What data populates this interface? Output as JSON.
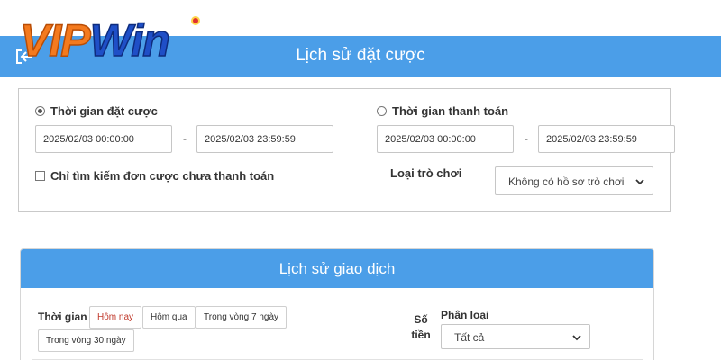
{
  "logo": {
    "part1": "VIP",
    "part2": "Win"
  },
  "bet_history": {
    "title": "Lịch sử đặt cược",
    "filters": {
      "bet_time_label": "Thời gian đặt cược",
      "bet_time_selected": true,
      "bet_start": "2025/02/03 00:00:00",
      "bet_end": "2025/02/03 23:59:59",
      "payment_time_label": "Thời gian thanh toán",
      "payment_start": "2025/02/03 00:00:00",
      "payment_end": "2025/02/03 23:59:59",
      "separator": "-",
      "unpaid_only_label": "Chỉ tìm kiếm đơn cược chưa thanh toán",
      "game_type_label": "Loại trò chơi",
      "game_type_value": "Không có hồ sơ trò chơi"
    }
  },
  "transaction_history": {
    "title": "Lịch sử giao dịch",
    "time_label": "Thời gian",
    "time_options": [
      "Hôm nay",
      "Hôm qua",
      "Trong vòng 7 ngày",
      "Trong vòng 30 ngày"
    ],
    "amount_label": "Số tiền",
    "category_label": "Phân loại",
    "category_value": "Tất cả"
  },
  "colors": {
    "header_blue": "#4b9ee8",
    "active_pill_text": "#c0392b"
  }
}
